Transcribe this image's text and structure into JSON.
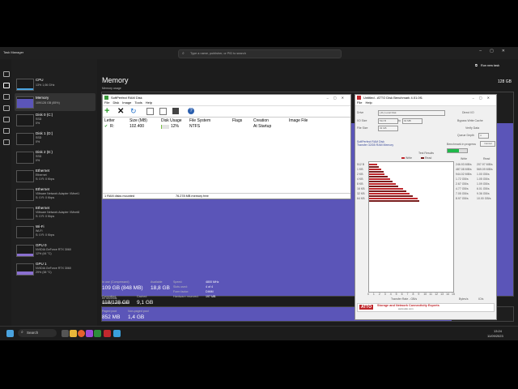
{
  "app": {
    "title": "Task Manager",
    "search_placeholder": "Type a name, publisher, or PID to search",
    "section": "Performance",
    "run_task": "Run new task"
  },
  "perf_items": [
    {
      "name": "CPU",
      "sub": "13%  1,06 GHz"
    },
    {
      "name": "Memory",
      "sub": "109/128 GB (85%)"
    },
    {
      "name": "Disk 0 (C:)",
      "sub": "SSD",
      "sub2": "0%"
    },
    {
      "name": "Disk 1 (D:)",
      "sub": "SSD",
      "sub2": "0%"
    },
    {
      "name": "Disk 2 (E:)",
      "sub": "SSD",
      "sub2": "0%"
    },
    {
      "name": "Ethernet",
      "sub": "Ethernet",
      "sub2": "S: 0  R: 0 Kbps"
    },
    {
      "name": "Ethernet",
      "sub": "VMware Network Adapter VMnet1",
      "sub2": "S: 0  R: 0 Kbps"
    },
    {
      "name": "Ethernet",
      "sub": "VMware Network Adapter VMnet8",
      "sub2": "S: 0  R: 0 Kbps"
    },
    {
      "name": "Wi-Fi",
      "sub": "Wi-Fi",
      "sub2": "S: 0  R: 0 Kbps"
    },
    {
      "name": "GPU 0",
      "sub": "NVIDIA GeForce RTX 3060",
      "sub2": "12% (44 °C)"
    },
    {
      "name": "GPU 1",
      "sub": "NVIDIA GeForce RTX 3060",
      "sub2": "29% (38 °C)"
    }
  ],
  "memory": {
    "title": "Memory",
    "total": "128 GB",
    "usage_label": "Memory usage",
    "time_label": "60 seconds",
    "composition_label": "Memory composition",
    "usage_fraction": 0.85,
    "stats": {
      "in_use_label": "In use (Compressed)",
      "in_use": "109 GB (848 MB)",
      "available_label": "Available",
      "available": "18,8 GB",
      "committed_label": "Committed",
      "committed": "118/128 GB",
      "cached_label": "Cached",
      "cached": "9,1 GB",
      "paged_label": "Paged pool",
      "paged": "852 MB",
      "nonpaged_label": "Non-paged pool",
      "nonpaged": "1,4 GB",
      "speed_label": "Speed:",
      "speed": "4800 MHz",
      "slots_label": "Slots used:",
      "slots": "4 of 4",
      "form_label": "Form factor:",
      "form": "DIMM",
      "hw_label": "Hardware reserved:",
      "hw": "197 MB"
    }
  },
  "ramdisk": {
    "title": "SoftPerfect RAM Disk",
    "menu": [
      "File",
      "Disk",
      "Image",
      "Tools",
      "Help"
    ],
    "headers": [
      "Letter",
      "Size (MB)",
      "Disk Usage",
      "File System",
      "Flags",
      "Creation",
      "Image File"
    ],
    "row": {
      "letter": "R:",
      "size": "102.400",
      "usage": "12%",
      "usage_fraction": 0.12,
      "fs": "NTFS",
      "flags": "",
      "creation": "At Startup",
      "image": ""
    },
    "status_left": "1 RAM disks mounted",
    "status_right": "76.278 MB memory free"
  },
  "atto": {
    "title": "Untitled - ATTO Disk Benchmark 4.01.0f1",
    "menu": [
      "File",
      "Help"
    ],
    "drive_label": "Drive",
    "drive": "[-R-] Local Disk",
    "io_label": "I/O Size",
    "io_from": "512 B",
    "io_to": "64 MB",
    "file_label": "File Size",
    "file": "32 GB",
    "direct_io": "Direct I/O",
    "bypass": "Bypass Write Cache",
    "verify": "Verify Data",
    "queue_label": "Queue Depth",
    "queue": "4",
    "desc": "SoftPerfect RAM Disk",
    "desc2": "Transfer 32GB RAM Memory",
    "progress_label": "Benchmark in progress",
    "cancel": "Cancel",
    "results_label": "Test Results",
    "write_label": "Write",
    "read_label": "Read",
    "sizes": [
      "512 B",
      "1 KB",
      "2 KB",
      "4 KB",
      "8 KB",
      "16 KB",
      "32 KB",
      "64 KB"
    ],
    "write": [
      "246.93 MB/s",
      "487.08 MB/s",
      "944.02 MB/s",
      "1.72 GB/s",
      "2.67 GB/s",
      "4.77 GB/s",
      "7.05 GB/s",
      "8.97 GB/s"
    ],
    "read": [
      "207.97 MB/s",
      "569.09 MB/s",
      "1.00 GB/s",
      "1.05 GB/s",
      "1.09 GB/s",
      "6.01 GB/s",
      "9.36 GB/s",
      "10.00 GB/s"
    ],
    "write_frac": [
      0.1,
      0.14,
      0.18,
      0.25,
      0.32,
      0.4,
      0.48,
      0.58
    ],
    "read_frac": [
      0.12,
      0.17,
      0.22,
      0.28,
      0.35,
      0.44,
      0.52,
      0.6
    ],
    "axis": [
      "0",
      "1",
      "2",
      "3",
      "4",
      "5",
      "6",
      "7",
      "8",
      "9",
      "10",
      "11",
      "12",
      "13",
      "14",
      "15"
    ],
    "axis_label": "Transfer Rate - GB/s",
    "units_b": "Bytes/s",
    "units_io": "IO/s",
    "logo": "ATTO",
    "tagline": "Storage and Network Connectivity Experts",
    "url": "www.atto.com"
  },
  "taskbar": {
    "search": "Search",
    "time": "13:24",
    "date": "11/09/2023"
  }
}
